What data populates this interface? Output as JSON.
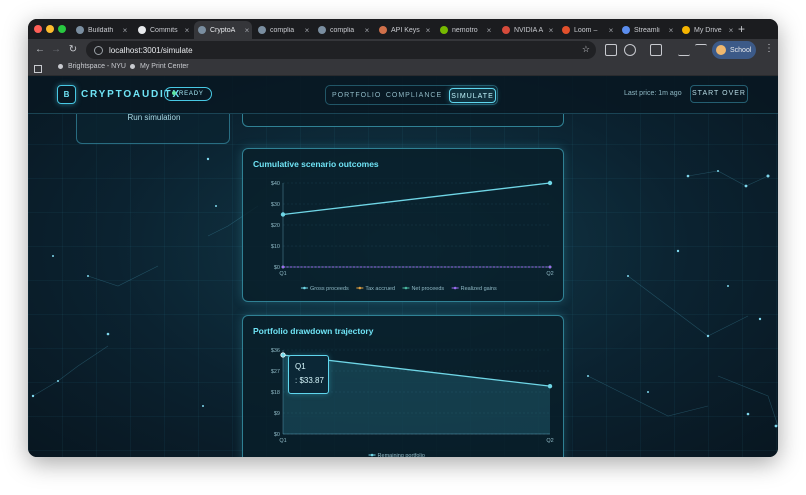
{
  "browser": {
    "tabs": [
      {
        "label": "Buildath",
        "icon": "globe-icon"
      },
      {
        "label": "Commits",
        "icon": "github-icon"
      },
      {
        "label": "CryptoA",
        "icon": "globe-icon",
        "active": true
      },
      {
        "label": "complia",
        "icon": "globe-icon"
      },
      {
        "label": "complia",
        "icon": "globe-icon"
      },
      {
        "label": "API Keys",
        "icon": "key-icon"
      },
      {
        "label": "nemotro",
        "icon": "nvidia-icon"
      },
      {
        "label": "NVIDIA A",
        "icon": "gmail-icon"
      },
      {
        "label": "Loom –",
        "icon": "loom-icon"
      },
      {
        "label": "Streamli",
        "icon": "streamlit-icon"
      },
      {
        "label": "My Drive",
        "icon": "drive-icon"
      }
    ],
    "url": "localhost:3001/simulate",
    "profile": "School",
    "bookmarks": [
      "Brightspace - NYU",
      "My Print Center"
    ]
  },
  "app": {
    "logo_letter": "B",
    "brand": "CRYPTOAUDITX",
    "status": "READY",
    "nav": [
      "PORTFOLIO",
      "COMPLIANCE",
      "SIMULATE"
    ],
    "active_nav": "SIMULATE",
    "last_price": "Last price: 1m ago",
    "start_over": "START OVER",
    "run_simulation": "Run simulation"
  },
  "colors": {
    "accent": "#48c8e4",
    "gross": "#6fd6e6",
    "tax": "#e0a040",
    "net": "#4ab8a0",
    "realized": "#9a6cf0"
  },
  "chart_data": [
    {
      "type": "line",
      "title": "Cumulative scenario outcomes",
      "categories": [
        "Q1",
        "Q2"
      ],
      "y_ticks": [
        "$0",
        "$10",
        "$20",
        "$30",
        "$40"
      ],
      "ylim": [
        0,
        40
      ],
      "series": [
        {
          "name": "Gross proceeds",
          "values": [
            25,
            40
          ],
          "color": "#6fd6e6"
        },
        {
          "name": "Tax accrued",
          "values": [
            0,
            0
          ],
          "color": "#e0a040"
        },
        {
          "name": "Net proceeds",
          "values": [
            0,
            0
          ],
          "color": "#4ab8a0"
        },
        {
          "name": "Realized gains",
          "values": [
            0,
            0
          ],
          "color": "#9a6cf0"
        }
      ],
      "legend": "bottom"
    },
    {
      "type": "area",
      "title": "Portfolio drawdown trajectory",
      "categories": [
        "Q1",
        "Q2"
      ],
      "y_ticks": [
        "$0",
        "$9",
        "$18",
        "$27",
        "$36"
      ],
      "ylim": [
        0,
        36
      ],
      "series": [
        {
          "name": "Remaining portfolio",
          "values": [
            33.87,
            20.5
          ],
          "color": "#6fd6e6"
        }
      ],
      "legend": "bottom",
      "tooltip": {
        "label": "Q1",
        "value": ": $33.87"
      }
    }
  ]
}
